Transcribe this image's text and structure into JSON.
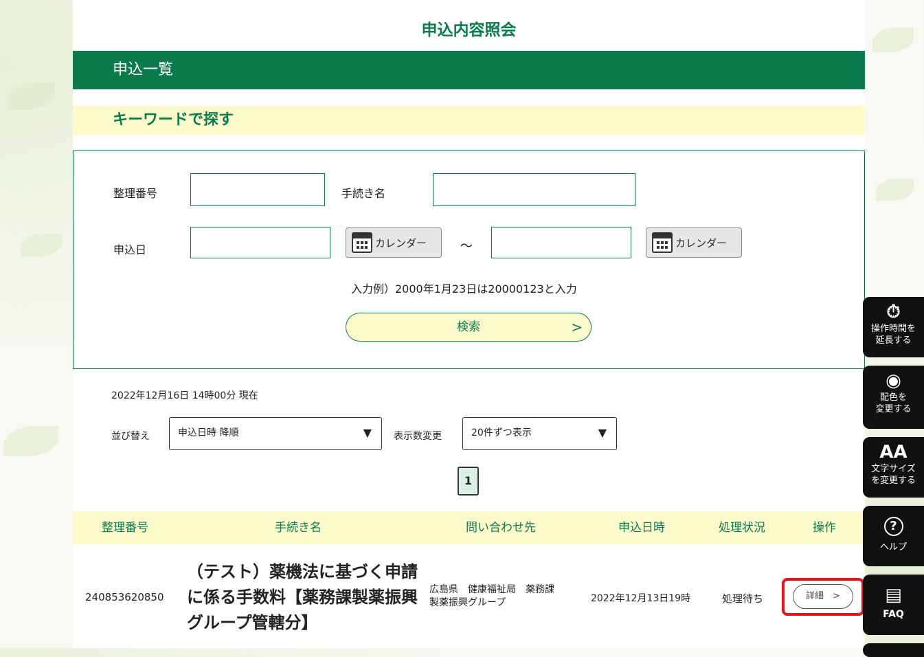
{
  "page_title": "申込内容照会",
  "section_title": "申込一覧",
  "search_heading": "キーワードで探す",
  "form": {
    "ref_number_label": "整理番号",
    "ref_number_value": "",
    "procedure_label": "手続き名",
    "procedure_value": "",
    "date_label": "申込日",
    "date_from_value": "",
    "date_to_value": "",
    "calendar_label": "カレンダー",
    "range_separator": "～",
    "example": "入力例）2000年1月23日は20000123と入力",
    "search_label": "検索",
    "search_arrow": ">"
  },
  "timestamp": "2022年12月16日 14時00分 現在",
  "sort": {
    "label": "並び替え",
    "selected": "申込日時 降順",
    "per_page_label": "表示数変更",
    "per_page_selected": "20件ずつ表示"
  },
  "pagination": {
    "current": "1"
  },
  "table": {
    "headers": [
      "整理番号",
      "手続き名",
      "問い合わせ先",
      "申込日時",
      "処理状況",
      "操作"
    ],
    "rows": [
      {
        "ref_number": "240853620850",
        "procedure": "（テスト）薬機法に基づく申請に係る手数料【薬務課製薬振興グループ管轄分】",
        "contact_line1": "広島県　健康福祉局　薬務課",
        "contact_line2": "製薬振興グループ",
        "applied_at": "2022年12月13日19時",
        "status": "処理待ち",
        "action": "詳細　>"
      }
    ]
  },
  "sidebar": {
    "extend": "操作時間を\n延長する",
    "color": "配色を\n変更する",
    "font": "文字サイズ\nを変更する",
    "help": "ヘルプ",
    "faq": "FAQ",
    "font_icon": "AA",
    "help_icon": "?",
    "faq_icon": "▤",
    "extend_icon": "⏱",
    "color_icon": "◉"
  },
  "colors": {
    "brand_green": "#0b7a4c",
    "accent_yellow": "#fdfacb",
    "highlight_red": "#e8141c"
  }
}
